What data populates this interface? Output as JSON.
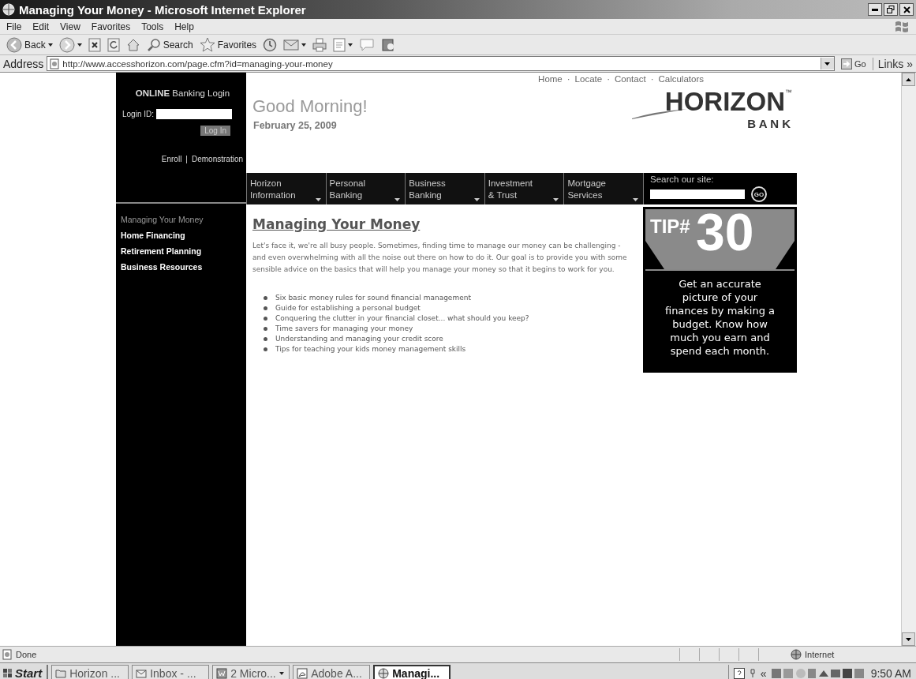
{
  "window": {
    "title": "Managing Your Money - Microsoft Internet Explorer"
  },
  "menu": [
    "File",
    "Edit",
    "View",
    "Favorites",
    "Tools",
    "Help"
  ],
  "toolbar": [
    {
      "kind": "back",
      "label": "Back",
      "dropdown": true
    },
    {
      "kind": "forward",
      "dropdown": true
    },
    {
      "kind": "stop"
    },
    {
      "kind": "refresh"
    },
    {
      "kind": "home"
    },
    {
      "kind": "search",
      "label": "Search"
    },
    {
      "kind": "favorites",
      "label": "Favorites"
    },
    {
      "kind": "history"
    },
    {
      "kind": "mail",
      "dropdown": true
    },
    {
      "kind": "print"
    },
    {
      "kind": "edit",
      "dropdown": true
    },
    {
      "kind": "discuss"
    },
    {
      "kind": "research"
    }
  ],
  "address": {
    "label": "Address",
    "url": "http://www.accesshorizon.com/page.cfm?id=managing-your-money",
    "go": "Go",
    "links": "Links »"
  },
  "page": {
    "login": {
      "title": "**ONLINE** Banking Login",
      "field_label": "Login ID:",
      "button": "Log In",
      "links": [
        "Enroll",
        "Demonstration"
      ],
      "separator": "|"
    },
    "side_nav": [
      {
        "label": "Managing Your Money",
        "selected": true
      },
      {
        "label": "Home Financing",
        "selected": false
      },
      {
        "label": "Retirement Planning",
        "selected": false
      },
      {
        "label": "Business Resources",
        "selected": false
      }
    ],
    "top_links": [
      "Home",
      "Locate",
      "Contact",
      "Calculators"
    ],
    "top_link_separator": "·",
    "greeting": "Good Morning!",
    "date": "February 25, 2009",
    "logo": {
      "name": "HORIZON",
      "mark": "™",
      "sub": "B A N K"
    },
    "nav": [
      {
        "lines": [
          "Horizon",
          "Information"
        ]
      },
      {
        "lines": [
          "Personal",
          "Banking"
        ]
      },
      {
        "lines": [
          "Business",
          "Banking"
        ]
      },
      {
        "lines": [
          "Investment",
          "& Trust"
        ]
      },
      {
        "lines": [
          "Mortgage",
          "Services"
        ]
      }
    ],
    "search": {
      "label": "Search our site:",
      "button": "GO"
    },
    "article": {
      "heading": "Managing Your Money",
      "paragraph": "Let's face it, we're all busy people. Sometimes, finding time to manage our money can be challenging - and even overwhelming with all the noise out there on how to do it. Our goal is to provide you with some sensible advice on the basics that will help you manage your money so that it begins to work for you.",
      "bullets": [
        "Six basic money rules for sound financial management",
        "Guide for establishing a personal budget",
        "Conquering the clutter in your financial closet... what should you keep?",
        "Time savers for managing your money",
        "Understanding and managing your credit score",
        "Tips for teaching your kids money management skills"
      ]
    },
    "tip": {
      "label": "TIP#",
      "number": "30",
      "text": "Get an accurate picture of your finances by making a budget. Know how much you earn and spend each month."
    }
  },
  "status": {
    "text": "Done",
    "zone": "Internet"
  },
  "taskbar": {
    "start": "Start",
    "tasks": [
      {
        "kind": "folder",
        "label": "Horizon ...",
        "selected": false
      },
      {
        "kind": "mail",
        "label": "Inbox - ...",
        "selected": false
      },
      {
        "kind": "doc",
        "label": "2 Micro...",
        "selected": false,
        "dropdown": true
      },
      {
        "kind": "pdf",
        "label": "Adobe A...",
        "selected": false
      },
      {
        "kind": "browser",
        "label": "Managi...",
        "selected": true
      }
    ],
    "tray_expand": "«",
    "clock": "9:50 AM"
  }
}
